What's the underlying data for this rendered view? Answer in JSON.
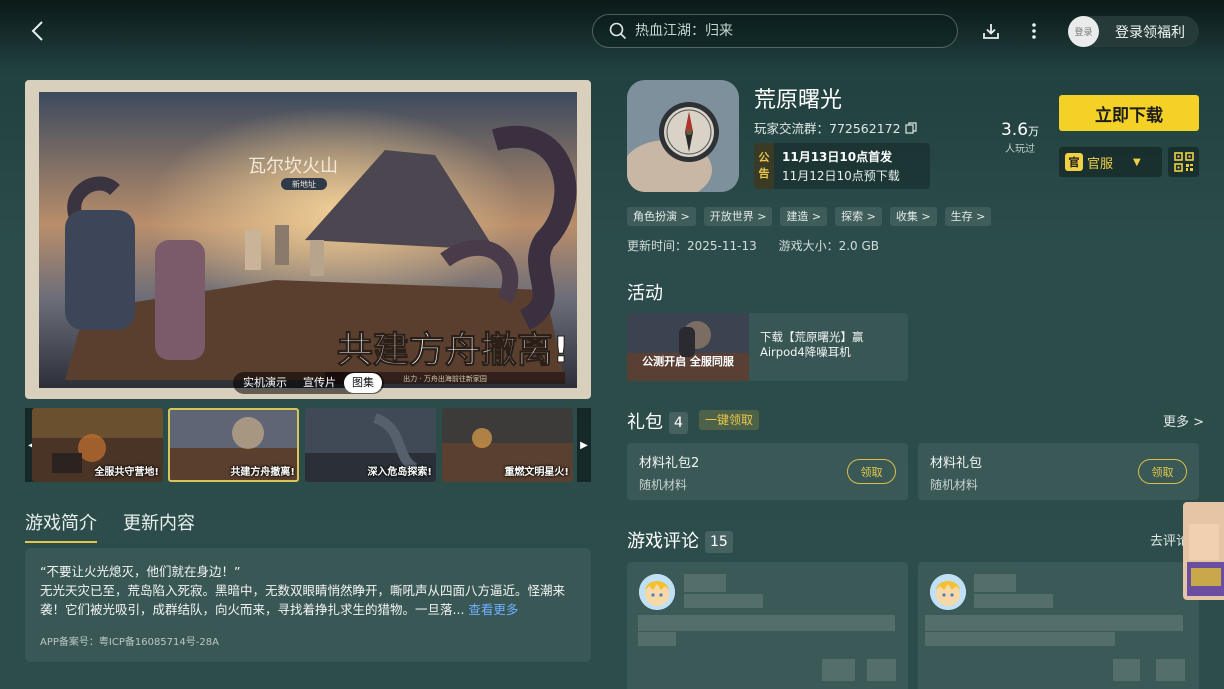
{
  "header": {
    "search_placeholder": "热血江湖：归来",
    "login_avatar_text": "登录",
    "login_label": "登录领福利"
  },
  "media": {
    "tabs": [
      "实机演示",
      "宣传片",
      "图集"
    ],
    "active_tab": "图集",
    "banner_location": "瓦尔坎火山",
    "banner_location_sub": "新地址",
    "banner_title": "共建方舟撤离!",
    "banner_sub": "出力 · 万舟出海前往新家园",
    "thumbnails": [
      "全服共守营地!",
      "共建方舟撤离!",
      "深入危岛探索!",
      "重燃文明星火!"
    ]
  },
  "intro": {
    "tabs": [
      "游戏简介",
      "更新内容"
    ],
    "active_tab": "游戏简介",
    "line1": "“不要让火光熄灭，他们就在身边！”",
    "line2": "无光天灾已至，荒岛陷入死寂。黑暗中，无数双眼睛悄然睁开，嘶吼声从四面八方逼近。怪潮来袭！它们被光吸引，成群结队，向火而来，寻找着挣扎求生的猎物。一旦落...",
    "more_link": "查看更多",
    "icp": "APP备案号：粤ICP备16085714号-28A"
  },
  "game": {
    "title": "荒原曙光",
    "group_label": "玩家交流群：772562172",
    "notice_badge": [
      "公",
      "告"
    ],
    "notice_line1": "11月13日10点首发",
    "notice_line2": "11月12日10点预下载",
    "players_num": "3.6",
    "players_unit": "万",
    "players_label": "人玩过",
    "download_label": "立即下载",
    "channel_badge": "官",
    "channel_label": "官服",
    "tags": [
      "角色扮演 >",
      "开放世界 >",
      "建造 >",
      "探索 >",
      "收集 >",
      "生存 >"
    ],
    "update_time": "更新时间：2025-11-13",
    "size": "游戏大小：2.0 GB"
  },
  "activity": {
    "title": "活动",
    "image_caption": "公测开启 全服同服",
    "text_line1": "下载【荒原曙光】赢",
    "text_line2": "Airpod4降噪耳机"
  },
  "gifts": {
    "title": "礼包",
    "count": "4",
    "one_click": "一键领取",
    "more": "更多 >",
    "items": [
      {
        "name": "材料礼包2",
        "desc": "随机材料",
        "claim": "领取"
      },
      {
        "name": "材料礼包",
        "desc": "随机材料",
        "claim": "领取"
      }
    ]
  },
  "reviews": {
    "title": "游戏评论",
    "count": "15",
    "go_review": "去评论"
  },
  "colors": {
    "accent_yellow": "#f3d126",
    "claim_gold": "#d9bf4a",
    "link_blue": "#6fb0ff",
    "bg_teal": "#2b4c4a"
  }
}
